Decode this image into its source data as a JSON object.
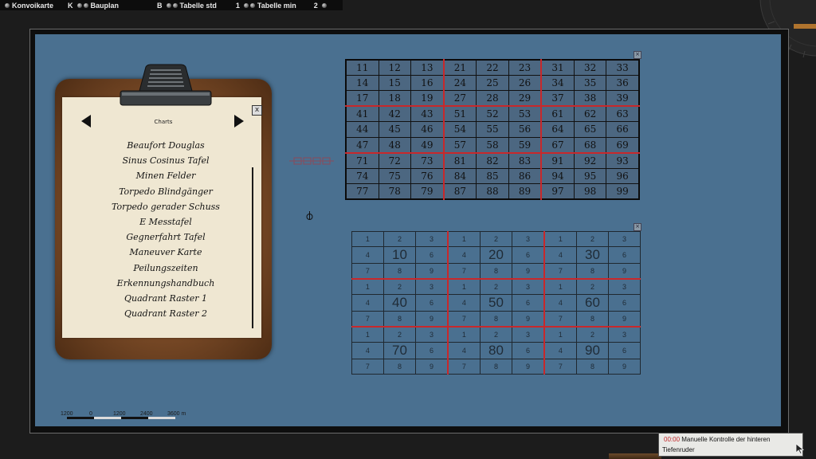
{
  "toolbar": {
    "items": [
      {
        "label": "Konvoikarte",
        "key": "K"
      },
      {
        "label": "Bauplan",
        "key": "B"
      },
      {
        "label": "Tabelle std",
        "key": "1"
      },
      {
        "label": "Tabelle min",
        "key": "2"
      }
    ]
  },
  "clipboard": {
    "title": "Charts",
    "close": "x",
    "items": [
      "Beaufort Douglas",
      "Sinus Cosinus Tafel",
      "Minen Felder",
      "Torpedo Blindgänger",
      "Torpedo gerader Schuss",
      "E Messtafel",
      "Gegnerfahrt Tafel",
      "Maneuver Karte",
      "Peilungszeiten",
      "Erkennungshandbuch",
      "Quadrant Raster 1",
      "Quadrant Raster 2"
    ]
  },
  "grid_top": {
    "rows": [
      [
        "11",
        "12",
        "13",
        "21",
        "22",
        "23",
        "31",
        "32",
        "33"
      ],
      [
        "14",
        "15",
        "16",
        "24",
        "25",
        "26",
        "34",
        "35",
        "36"
      ],
      [
        "17",
        "18",
        "19",
        "27",
        "28",
        "29",
        "37",
        "38",
        "39"
      ],
      [
        "41",
        "42",
        "43",
        "51",
        "52",
        "53",
        "61",
        "62",
        "63"
      ],
      [
        "44",
        "45",
        "46",
        "54",
        "55",
        "56",
        "64",
        "65",
        "66"
      ],
      [
        "47",
        "48",
        "49",
        "57",
        "58",
        "59",
        "67",
        "68",
        "69"
      ],
      [
        "71",
        "72",
        "73",
        "81",
        "82",
        "83",
        "91",
        "92",
        "93"
      ],
      [
        "74",
        "75",
        "76",
        "84",
        "85",
        "86",
        "94",
        "95",
        "96"
      ],
      [
        "77",
        "78",
        "79",
        "87",
        "88",
        "89",
        "97",
        "98",
        "99"
      ]
    ]
  },
  "grid_bottom": {
    "rows": [
      [
        "1",
        "2",
        "3",
        "1",
        "2",
        "3",
        "1",
        "2",
        "3"
      ],
      [
        "4",
        "10",
        "6",
        "4",
        "20",
        "6",
        "4",
        "30",
        "6"
      ],
      [
        "7",
        "8",
        "9",
        "7",
        "8",
        "9",
        "7",
        "8",
        "9"
      ],
      [
        "1",
        "2",
        "3",
        "1",
        "2",
        "3",
        "1",
        "2",
        "3"
      ],
      [
        "4",
        "40",
        "6",
        "4",
        "50",
        "6",
        "4",
        "60",
        "6"
      ],
      [
        "7",
        "8",
        "9",
        "7",
        "8",
        "9",
        "7",
        "8",
        "9"
      ],
      [
        "1",
        "2",
        "3",
        "1",
        "2",
        "3",
        "1",
        "2",
        "3"
      ],
      [
        "4",
        "70",
        "6",
        "4",
        "80",
        "6",
        "4",
        "90",
        "6"
      ],
      [
        "7",
        "8",
        "9",
        "7",
        "8",
        "9",
        "7",
        "8",
        "9"
      ]
    ]
  },
  "scale": {
    "labels": [
      "1200",
      "0",
      "1200",
      "2400",
      "3600 m"
    ]
  },
  "message": {
    "time": "00:00",
    "text1": "Manuelle Kontrolle der hinteren",
    "text2": "Tiefenruder"
  },
  "colors": {
    "map": "#4a7090",
    "grid_divider": "#c8282b",
    "message_time": "#c3282b"
  }
}
